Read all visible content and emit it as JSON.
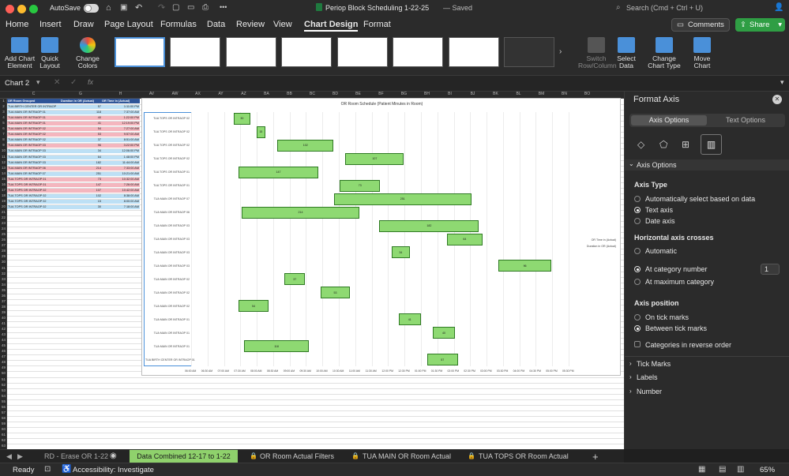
{
  "window": {
    "autosave_label": "AutoSave",
    "title": "Periop Block Scheduling 1-22-25",
    "save_state": "— Saved",
    "search_placeholder": "Search (Cmd + Ctrl + U)"
  },
  "menu": [
    "Home",
    "Insert",
    "Draw",
    "Page Layout",
    "Formulas",
    "Data",
    "Review",
    "View",
    "Chart Design",
    "Format"
  ],
  "menu_active": "Chart Design",
  "comments_label": "Comments",
  "share_label": "Share",
  "ribbon": {
    "add_chart": "Add Chart Element",
    "quick_layout": "Quick Layout",
    "change_colors": "Change Colors",
    "switch": "Switch Row/Column",
    "select_data": "Select Data",
    "change_type": "Change Chart Type",
    "move_chart": "Move Chart"
  },
  "name_box": "Chart 2",
  "fx": "fx",
  "columns": [
    "C",
    "G",
    "H",
    "AV",
    "AW",
    "AX",
    "AY",
    "AZ",
    "BA",
    "BB",
    "BC",
    "BD",
    "BE",
    "BF",
    "BG",
    "BH",
    "BI",
    "BJ",
    "BK",
    "BL",
    "BM",
    "BN",
    "BO"
  ],
  "rows": [
    "1",
    "2",
    "3",
    "4",
    "5",
    "6",
    "7",
    "8",
    "9",
    "10",
    "11",
    "12",
    "13",
    "14",
    "15",
    "16",
    "17",
    "18",
    "19",
    "20",
    "21",
    "22",
    "23",
    "24",
    "25",
    "26",
    "27",
    "28",
    "29",
    "30",
    "31",
    "32",
    "33",
    "34",
    "35",
    "36",
    "37",
    "38",
    "39",
    "40",
    "41",
    "42",
    "43",
    "44",
    "45",
    "46",
    "47",
    "48",
    "49",
    "50",
    "51",
    "52",
    "53",
    "54",
    "55",
    "56",
    "57",
    "58",
    "59",
    "60",
    "61",
    "62",
    "63"
  ],
  "table": {
    "headers": [
      "OR Room Grouped",
      "Duration in OR (Actual)",
      "OR Time in (Actual)"
    ],
    "rows": [
      {
        "room": "TUA BIRTH CENTER OR INTRAOP",
        "dur": "57",
        "time": "1:11:00 PM",
        "c": "blue"
      },
      {
        "room": "TUA MAIN OR INTRAOP 01",
        "dur": "118",
        "time": "7:37:00 AM",
        "c": "blue"
      },
      {
        "room": "TUA MAIN OR INTRAOP 01",
        "dur": "40",
        "time": "1:22:00 PM",
        "c": "pink"
      },
      {
        "room": "TUA MAIN OR INTRAOP 01",
        "dur": "41",
        "time": "12:19:00 PM",
        "c": "pink"
      },
      {
        "room": "TUA MAIN OR INTRAOP 02",
        "dur": "54",
        "time": "7:27:00 AM",
        "c": "pink"
      },
      {
        "room": "TUA MAIN OR INTRAOP 02",
        "dur": "53",
        "time": "9:57:00 AM",
        "c": "pink"
      },
      {
        "room": "TUA MAIN OR INTRAOP 02",
        "dur": "37",
        "time": "8:51:00 AM",
        "c": "blue"
      },
      {
        "room": "TUA MAIN OR INTRAOP 03",
        "dur": "96",
        "time": "3:22:00 PM",
        "c": "pink"
      },
      {
        "room": "TUA MAIN OR INTRAOP 03",
        "dur": "34",
        "time": "12:06:00 PM",
        "c": "blue"
      },
      {
        "room": "TUA MAIN OR INTRAOP 03",
        "dur": "64",
        "time": "1:48:00 PM",
        "c": "blue"
      },
      {
        "room": "TUA MAIN OR INTRAOP 03",
        "dur": "182",
        "time": "11:44:00 AM",
        "c": "blue"
      },
      {
        "room": "TUA MAIN OR INTRAOP 06",
        "dur": "214",
        "time": "7:33:00 AM",
        "c": "pink"
      },
      {
        "room": "TUA MAIN OR INTRAOP 07",
        "dur": "251",
        "time": "10:21:00 AM",
        "c": "blue"
      },
      {
        "room": "TUA TOPS OR INTRAOP 01",
        "dur": "73",
        "time": "10:32:00 AM",
        "c": "pink"
      },
      {
        "room": "TUA TOPS OR INTRAOP 01",
        "dur": "147",
        "time": "7:26:00 AM",
        "c": "pink"
      },
      {
        "room": "TUA TOPS OR INTRAOP 02",
        "dur": "107",
        "time": "10:42:00 AM",
        "c": "pink"
      },
      {
        "room": "TUA TOPS OR INTRAOP 02",
        "dur": "102",
        "time": "8:38:00 AM",
        "c": "blue"
      },
      {
        "room": "TUA TOPS OR INTRAOP 02",
        "dur": "15",
        "time": "8:00:00 AM",
        "c": "blue"
      },
      {
        "room": "TUA TOPS OR INTRAOP 02",
        "dur": "30",
        "time": "7:18:00 AM",
        "c": "blue"
      }
    ]
  },
  "chart_data": {
    "type": "bar",
    "orientation": "horizontal-floating",
    "title": "OR Room Schedule (Patient Minutes in Room)",
    "categories": [
      "TUA TOPS OR INTRAOP 02",
      "TUA TOPS OR INTRAOP 02",
      "TUA TOPS OR INTRAOP 02",
      "TUA TOPS OR INTRAOP 02",
      "TUA TOPS OR INTRAOP 01",
      "TUA TOPS OR INTRAOP 01",
      "TUA MAIN OR INTRAOP 07",
      "TUA MAIN OR INTRAOP 06",
      "TUA MAIN OR INTRAOP 03",
      "TUA MAIN OR INTRAOP 03",
      "TUA MAIN OR INTRAOP 03",
      "TUA MAIN OR INTRAOP 03",
      "TUA MAIN OR INTRAOP 02",
      "TUA MAIN OR INTRAOP 02",
      "TUA MAIN OR INTRAOP 02",
      "TUA MAIN OR INTRAOP 01",
      "TUA MAIN OR INTRAOP 01",
      "TUA MAIN OR INTRAOP 01",
      "TUA BIRTH CENTER OR INTRAOP 01"
    ],
    "series": [
      {
        "name": "OR Time in (Actual)",
        "values": [
          "7:18 AM",
          "8:00 AM",
          "8:38 AM",
          "10:42 AM",
          "7:26 AM",
          "10:32 AM",
          "10:21 AM",
          "7:33 AM",
          "11:44 AM",
          "1:48 PM",
          "12:06 PM",
          "3:22 PM",
          "8:51 AM",
          "9:57 AM",
          "7:27 AM",
          "12:19 PM",
          "1:22 PM",
          "7:37 AM",
          "1:11 PM"
        ]
      },
      {
        "name": "Duration in OR (Actual)",
        "values": [
          30,
          15,
          102,
          107,
          147,
          73,
          251,
          214,
          182,
          64,
          34,
          96,
          37,
          53,
          54,
          41,
          40,
          118,
          57
        ]
      }
    ],
    "x_ticks": [
      "06:00 AM",
      "06:30 AM",
      "07:00 AM",
      "07:30 AM",
      "08:00 AM",
      "08:30 AM",
      "09:00 AM",
      "09:30 AM",
      "10:00 AM",
      "10:30 AM",
      "11:00 AM",
      "11:30 AM",
      "12:00 PM",
      "12:30 PM",
      "01:00 PM",
      "01:30 PM",
      "02:00 PM",
      "02:30 PM",
      "03:00 PM",
      "03:30 PM",
      "04:00 PM",
      "04:30 PM",
      "05:00 PM",
      "05:30 PM"
    ],
    "xlim": [
      "06:00 AM",
      "05:30 PM"
    ],
    "legend": "right",
    "grid": true
  },
  "pane": {
    "title": "Format Axis",
    "tab_axis": "Axis Options",
    "tab_text": "Text Options",
    "section": "Axis Options",
    "axis_type_h": "Axis Type",
    "opt_auto": "Automatically select based on data",
    "opt_text": "Text axis",
    "opt_date": "Date axis",
    "cross_h": "Horizontal axis crosses",
    "cross_auto": "Automatic",
    "cross_cat": "At category number",
    "cross_cat_val": "1",
    "cross_max": "At maximum category",
    "pos_h": "Axis position",
    "pos_on": "On tick marks",
    "pos_between": "Between tick marks",
    "reverse": "Categories in reverse order",
    "tick_marks": "Tick Marks",
    "labels": "Labels",
    "number": "Number"
  },
  "sheets": [
    "RD - Erase OR 1-22",
    "Data Combined 12-17 to 1-22",
    "OR Room Actual Filters",
    "TUA MAIN OR Room Actual",
    "TUA TOPS OR Room Actual"
  ],
  "sheet_active": "Data Combined 12-17 to 1-22",
  "status": {
    "ready": "Ready",
    "accessibility": "Accessibility: Investigate",
    "zoom": "65%"
  },
  "colors": {
    "bar_fill": "#8ed972",
    "bar_stroke": "#2f7a23",
    "blue_row": "#bde0f5",
    "pink_row": "#f4b6be",
    "accent": "#2f9e44"
  }
}
